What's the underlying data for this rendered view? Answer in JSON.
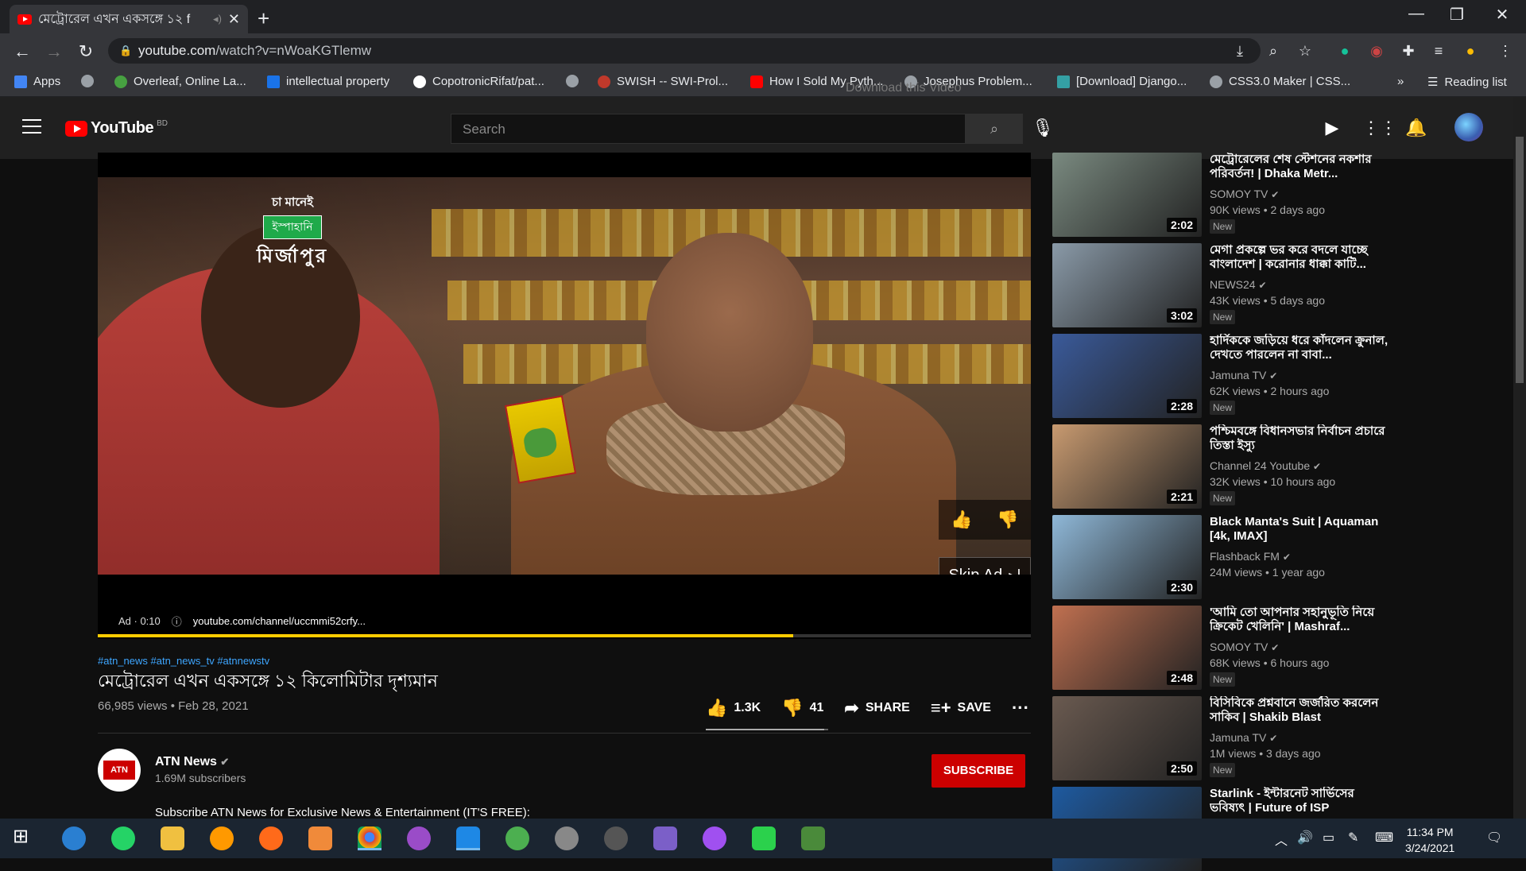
{
  "browser": {
    "tab_title": "মেট্রোরেল এখন একসঙ্গে ১২ f",
    "url_host": "youtube.com",
    "url_path": "/watch?v=nWoaKGTlemw",
    "bookmarks": [
      {
        "label": "Apps",
        "color": "#4285f4"
      },
      {
        "label": "",
        "color": "#9aa0a6"
      },
      {
        "label": "Overleaf, Online La...",
        "color": "#47a141"
      },
      {
        "label": "intellectual property",
        "color": "#1a73e8"
      },
      {
        "label": "CopotronicRifat/pat...",
        "color": "#ffffff"
      },
      {
        "label": "",
        "color": "#9aa0a6"
      },
      {
        "label": "SWISH -- SWI-Prol...",
        "color": "#c0392b"
      },
      {
        "label": "How I Sold My Pyth...",
        "color": "#ff0000"
      },
      {
        "label": "Josephus Problem...",
        "color": "#9aa0a6"
      },
      {
        "label": "[Download] Django...",
        "color": "#34a0a4"
      },
      {
        "label": "CSS3.0 Maker | CSS...",
        "color": "#9aa0a6"
      }
    ],
    "more_bookmarks": "»",
    "reading_list": "Reading list",
    "download_hint": "Download this Video"
  },
  "youtube": {
    "logo_text": "YouTube",
    "country": "BD",
    "search_placeholder": "Search"
  },
  "player": {
    "brand_line1": "চা মানেই",
    "brand_line2": "ইস্পাহানি",
    "brand_line3": "মির্জাপুর",
    "skip_label": "Skip Ad",
    "ad_label": "Ad · 0:10",
    "ad_url": "youtube.com/channel/uccmmi52crfy...",
    "progress": 0.745
  },
  "video": {
    "hashtags": "#atn_news #atn_news_tv #atnnewstv",
    "title": "মেট্রোরেল এখন একসঙ্গে ১২ কিলোমিটার দৃশ্যমান",
    "stats": "66,985 views • Feb 28, 2021",
    "likes": "1.3K",
    "dislikes": "41",
    "share": "SHARE",
    "save": "SAVE",
    "like_ratio": 0.97
  },
  "channel": {
    "name": "ATN News",
    "subscribers": "1.69M subscribers",
    "subscribe": "SUBSCRIBE",
    "avatar_text": "ATN",
    "description": "Subscribe ATN News for Exclusive News & Entertainment (IT'S FREE):"
  },
  "recommendations": [
    {
      "title": "মেট্রোরেলের শেষ স্টেশনের নকশার পরিবর্তন! | Dhaka Metr...",
      "channel": "SOMOY TV",
      "meta": "90K views • 2 days ago",
      "duration": "2:02",
      "new": "New",
      "thumb_color": "#7a8a80"
    },
    {
      "title": "মেগা প্রকল্পে ভর করে বদলে যাচ্ছে বাংলাদেশ | করোনার ধাক্কা কাটি...",
      "channel": "NEWS24",
      "meta": "43K views • 5 days ago",
      "duration": "3:02",
      "new": "New",
      "thumb_color": "#8a9aa8"
    },
    {
      "title": "হার্দিককে জড়িয়ে ধরে কাঁদলেন ক্রুনাল, দেখতে পারলেন না বাবা...",
      "channel": "Jamuna TV",
      "meta": "62K views • 2 hours ago",
      "duration": "2:28",
      "new": "New",
      "thumb_color": "#3a5a9a"
    },
    {
      "title": "পশ্চিমবঙ্গে বিধানসভার নির্বাচন প্রচারে তিস্তা ইস্যু",
      "channel": "Channel 24 Youtube",
      "meta": "32K views • 10 hours ago",
      "duration": "2:21",
      "new": "New",
      "thumb_color": "#c89a70"
    },
    {
      "title": "Black Manta's Suit | Aquaman [4k, IMAX]",
      "channel": "Flashback FM",
      "meta": "24M views • 1 year ago",
      "duration": "2:30",
      "new": "",
      "thumb_color": "#8fb8d8"
    },
    {
      "title": "'আমি তো আপনার সহানুভূতি নিয়ে ক্রিকেট খেলিনি' | Mashraf...",
      "channel": "SOMOY TV",
      "meta": "68K views • 6 hours ago",
      "duration": "2:48",
      "new": "New",
      "thumb_color": "#c07050"
    },
    {
      "title": "বিসিবিকে প্রশ্নবানে জর্জরিত করলেন সাকিব | Shakib Blast",
      "channel": "Jamuna TV",
      "meta": "1M views • 3 days ago",
      "duration": "2:50",
      "new": "New",
      "thumb_color": "#6a5a50"
    },
    {
      "title": "Starlink - ইন্টারনেট সার্ভিসের ভবিষ্যৎ | Future of ISP",
      "channel": "",
      "meta": "",
      "duration": "",
      "new": "",
      "thumb_color": "#1e5aa0"
    }
  ],
  "taskbar": {
    "time": "11:34 PM",
    "date": "3/24/2021"
  }
}
